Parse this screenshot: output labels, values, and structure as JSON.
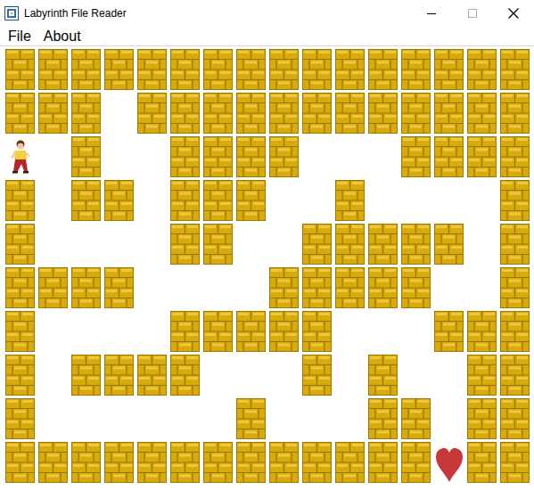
{
  "window": {
    "title": "Labyrinth File Reader"
  },
  "menu": [
    {
      "label": "File"
    },
    {
      "label": "About"
    }
  ],
  "maze": {
    "rows": [
      [
        "wall",
        "wall",
        "wall",
        "wall",
        "wall",
        "wall",
        "wall",
        "wall",
        "wall",
        "wall",
        "wall",
        "wall",
        "wall",
        "wall",
        "wall",
        "wall"
      ],
      [
        "wall",
        "wall",
        "wall",
        "open",
        "wall",
        "wall",
        "wall",
        "wall",
        "wall",
        "wall",
        "wall",
        "wall",
        "wall",
        "wall",
        "wall",
        "wall"
      ],
      [
        "player",
        "open",
        "wall",
        "open",
        "open",
        "wall",
        "wall",
        "wall",
        "wall",
        "open",
        "open",
        "open",
        "wall",
        "wall",
        "wall",
        "wall"
      ],
      [
        "wall",
        "open",
        "wall",
        "wall",
        "open",
        "wall",
        "wall",
        "wall",
        "open",
        "open",
        "wall",
        "open",
        "open",
        "open",
        "open",
        "wall"
      ],
      [
        "wall",
        "open",
        "open",
        "open",
        "open",
        "wall",
        "wall",
        "open",
        "open",
        "wall",
        "wall",
        "wall",
        "wall",
        "wall",
        "open",
        "wall"
      ],
      [
        "wall",
        "wall",
        "wall",
        "wall",
        "open",
        "open",
        "open",
        "open",
        "wall",
        "wall",
        "wall",
        "wall",
        "wall",
        "open",
        "open",
        "wall"
      ],
      [
        "wall",
        "open",
        "open",
        "open",
        "open",
        "wall",
        "wall",
        "wall",
        "wall",
        "wall",
        "open",
        "open",
        "open",
        "wall",
        "wall",
        "wall"
      ],
      [
        "wall",
        "open",
        "wall",
        "wall",
        "wall",
        "wall",
        "open",
        "open",
        "open",
        "wall",
        "open",
        "wall",
        "open",
        "open",
        "wall",
        "wall"
      ],
      [
        "wall",
        "open",
        "open",
        "open",
        "open",
        "open",
        "open",
        "wall",
        "open",
        "open",
        "open",
        "wall",
        "wall",
        "open",
        "wall",
        "wall"
      ],
      [
        "wall",
        "wall",
        "wall",
        "wall",
        "wall",
        "wall",
        "wall",
        "wall",
        "wall",
        "wall",
        "wall",
        "wall",
        "wall",
        "goal",
        "wall",
        "wall"
      ]
    ]
  }
}
